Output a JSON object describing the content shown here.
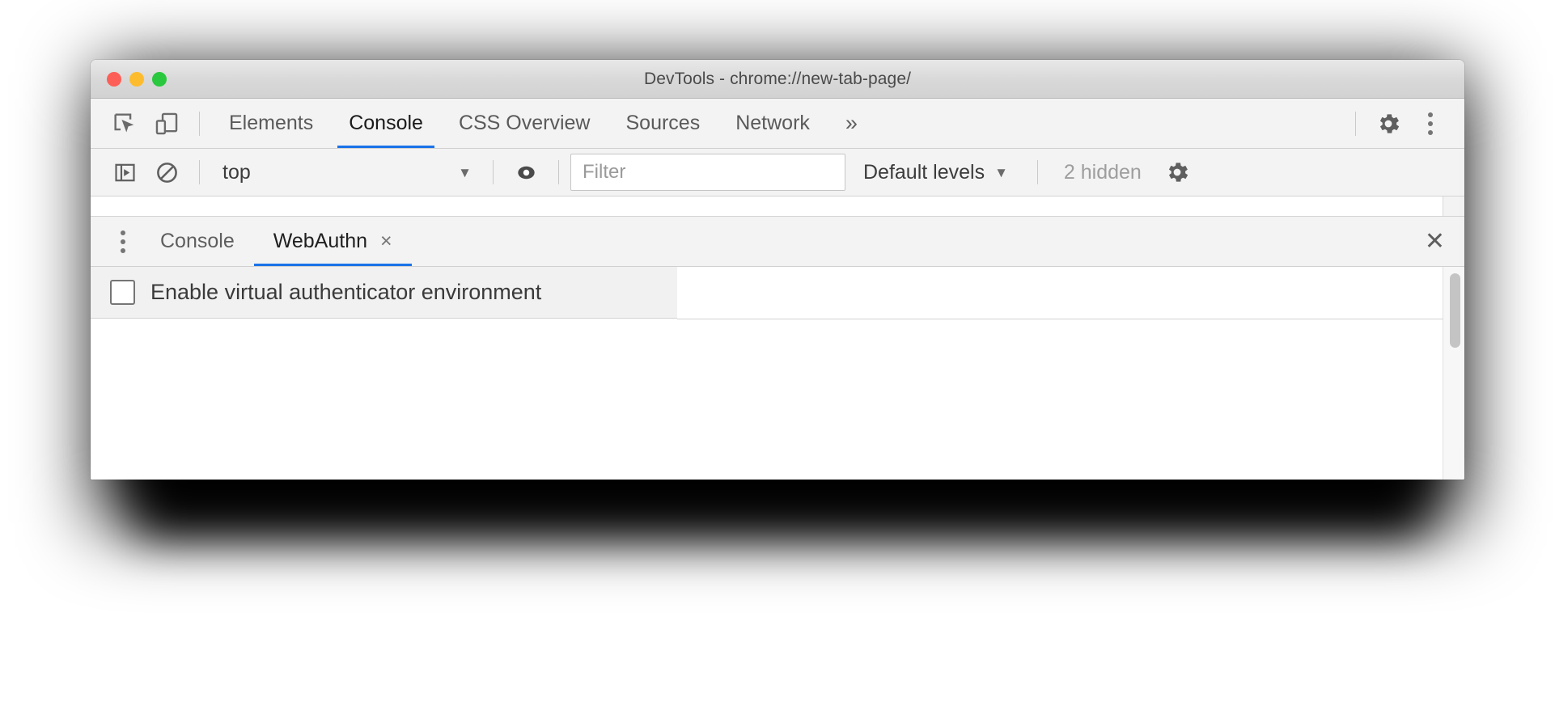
{
  "window": {
    "title": "DevTools - chrome://new-tab-page/",
    "traffic_lights": [
      "close",
      "minimize",
      "zoom"
    ],
    "colors": {
      "close": "#fc5f57",
      "minimize": "#fdbc2e",
      "zoom": "#29c83f",
      "accent": "#1a73e8",
      "toolbar_bg": "#f3f3f3",
      "titlebar_bg": "#d8d8d8"
    }
  },
  "main_toolbar": {
    "left_icons": [
      {
        "name": "inspect-element-icon",
        "title": "Inspect element"
      },
      {
        "name": "device-toolbar-icon",
        "title": "Toggle device toolbar"
      }
    ],
    "tabs": [
      {
        "label": "Elements",
        "active": false
      },
      {
        "label": "Console",
        "active": true
      },
      {
        "label": "CSS Overview",
        "active": false
      },
      {
        "label": "Sources",
        "active": false
      },
      {
        "label": "Network",
        "active": false
      }
    ],
    "overflow_label": "»",
    "right_icons": [
      {
        "name": "settings-gear-icon",
        "title": "Settings"
      },
      {
        "name": "more-options-icon",
        "title": "Customize and control DevTools"
      }
    ]
  },
  "console_toolbar": {
    "sidebar_toggle_icon": "console-sidebar-icon",
    "clear_console_icon": "clear-console-icon",
    "context": {
      "value": "top",
      "caret": "▼"
    },
    "live_expression_icon": "eye-icon",
    "filter": {
      "placeholder": "Filter",
      "value": ""
    },
    "log_levels": {
      "label": "Default levels",
      "caret": "▼"
    },
    "hidden_count": "2 hidden",
    "settings_icon": "settings-gear-icon"
  },
  "drawer": {
    "menu_icon": "drawer-more-options-icon",
    "tabs": [
      {
        "label": "Console",
        "active": false,
        "closable": false
      },
      {
        "label": "WebAuthn",
        "active": true,
        "closable": true,
        "close_glyph": "×"
      }
    ],
    "close_glyph": "✕"
  },
  "webauthn_panel": {
    "enable_checkbox": {
      "label": "Enable virtual authenticator environment",
      "checked": false
    }
  }
}
